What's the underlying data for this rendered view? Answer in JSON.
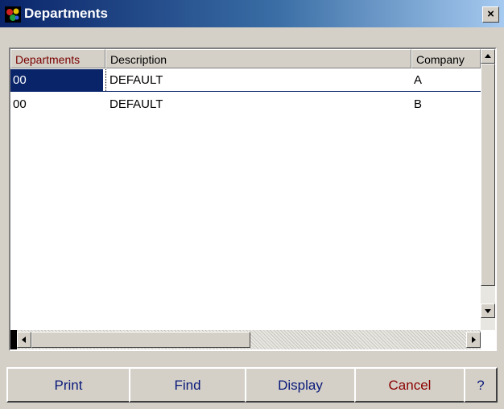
{
  "window": {
    "title": "Departments",
    "close_glyph": "✕"
  },
  "grid": {
    "columns": [
      "Departments",
      "Description",
      "Company"
    ],
    "rows": [
      [
        "00",
        "DEFAULT",
        "A"
      ],
      [
        "00",
        "DEFAULT",
        "B"
      ]
    ]
  },
  "buttons": {
    "print": "Print",
    "find": "Find",
    "display": "Display",
    "cancel": "Cancel",
    "help": "?"
  },
  "colors": {
    "title_start": "#0a246a",
    "title_end": "#a6caf0",
    "selection": "#0a246a",
    "cancel_text": "#8b0000",
    "button_text": "#0a1a7a"
  }
}
